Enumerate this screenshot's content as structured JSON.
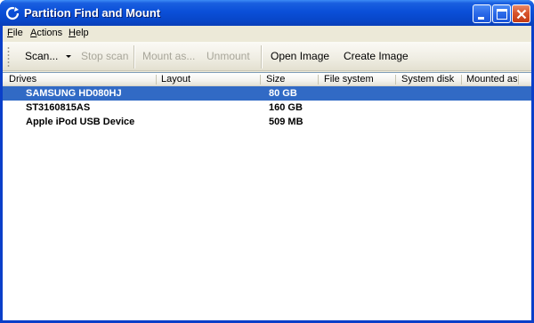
{
  "window": {
    "title": "Partition Find and Mount"
  },
  "menu": {
    "items": [
      {
        "label": "File",
        "accel": "F",
        "rest": "ile"
      },
      {
        "label": "Actions",
        "accel": "A",
        "rest": "ctions"
      },
      {
        "label": "Help",
        "accel": "H",
        "rest": "elp"
      }
    ]
  },
  "toolbar": {
    "scan": "Scan...",
    "stop_scan": "Stop scan",
    "mount_as": "Mount as...",
    "unmount": "Unmount",
    "open_image": "Open Image",
    "create_image": "Create Image"
  },
  "table": {
    "columns": [
      "Drives",
      "Layout",
      "Size",
      "File system",
      "System disk",
      "Mounted as"
    ],
    "rows": [
      {
        "drive": "SAMSUNG HD080HJ",
        "layout": "",
        "size": "80 GB",
        "file_system": "",
        "system_disk": "",
        "mounted_as": "",
        "selected": true
      },
      {
        "drive": "ST3160815AS",
        "layout": "",
        "size": "160 GB",
        "file_system": "",
        "system_disk": "",
        "mounted_as": "",
        "selected": false
      },
      {
        "drive": "Apple iPod USB Device",
        "layout": "",
        "size": "509 MB",
        "file_system": "",
        "system_disk": "",
        "mounted_as": "",
        "selected": false
      }
    ]
  },
  "colors": {
    "titlebar": "#0a4fd8",
    "selection": "#316ac5",
    "face": "#ece9d8"
  },
  "icons": {
    "app": "refresh-circle-icon",
    "minimize": "minimize-icon",
    "maximize": "maximize-icon",
    "close": "close-icon"
  }
}
